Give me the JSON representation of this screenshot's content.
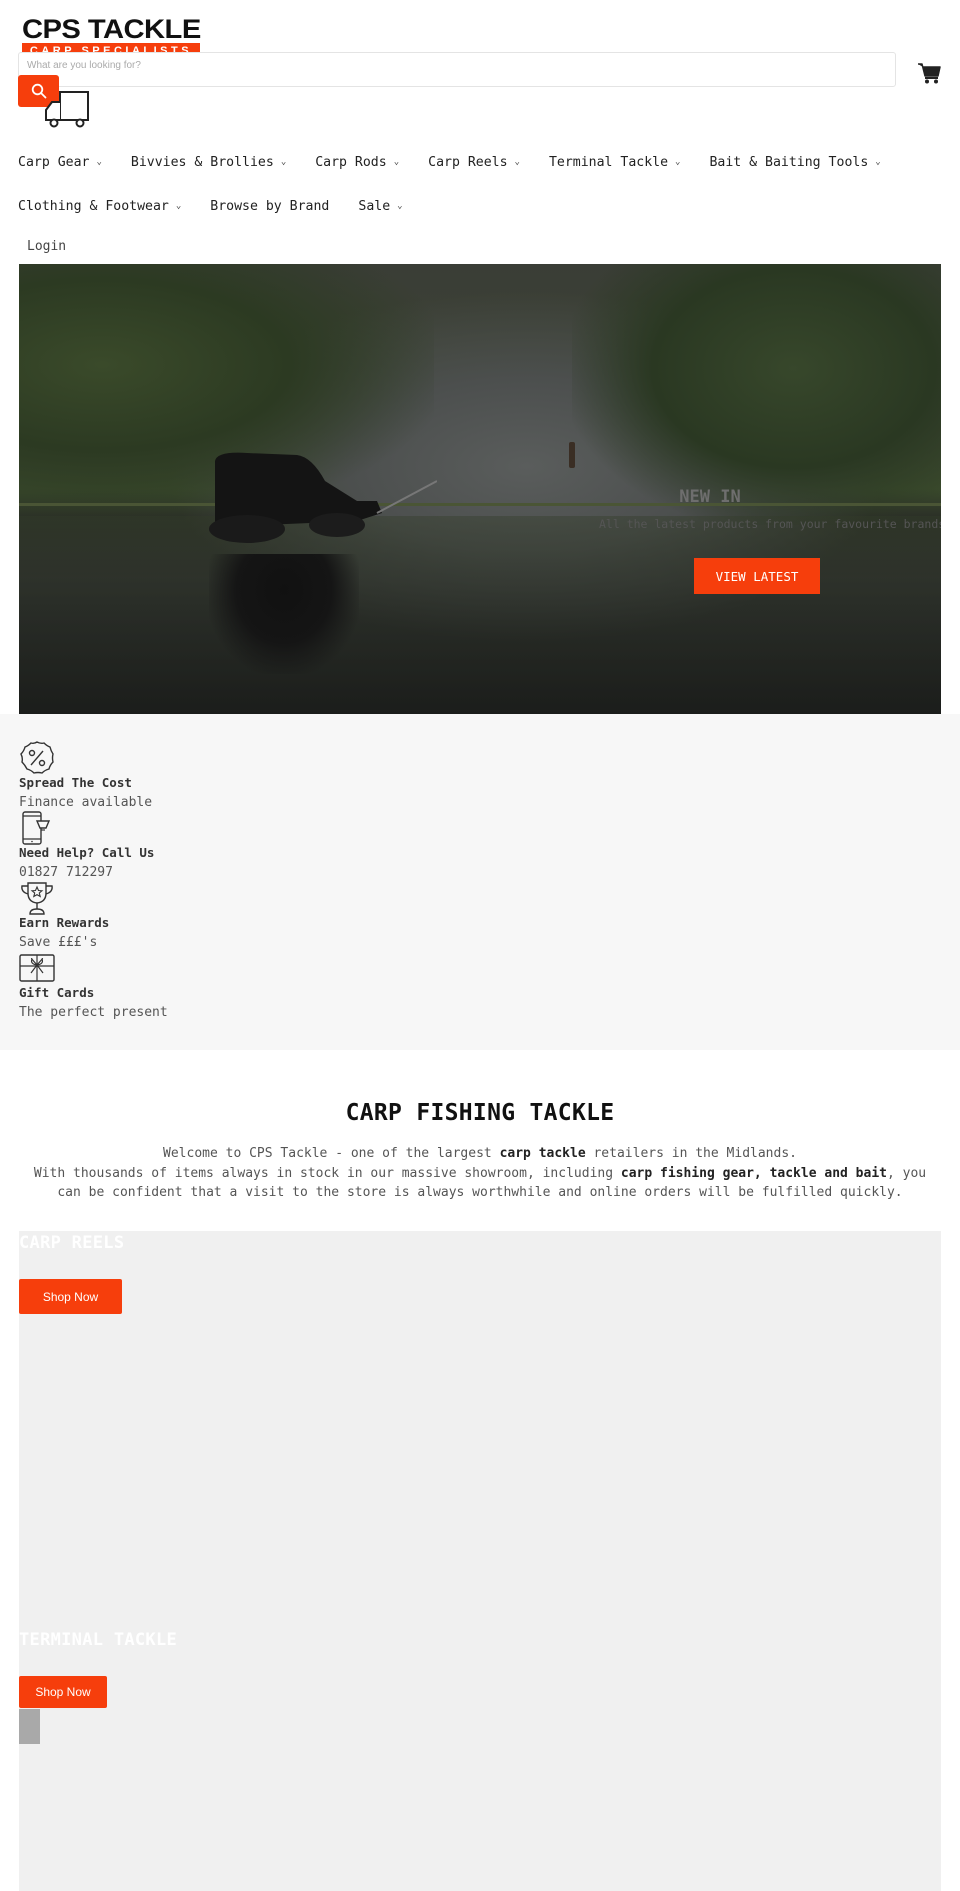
{
  "brand": {
    "logo_top": "CPS TACKLE",
    "logo_bottom": "CARP SPECIALISTS",
    "accent_color": "#f63e0c"
  },
  "search": {
    "placeholder": "What are you looking for?",
    "value": "",
    "button_icon": "search-icon"
  },
  "header_icons": {
    "delivery": "truck-icon",
    "cart": "cart-icon"
  },
  "nav": {
    "row1": [
      {
        "label": "Carp Gear",
        "dropdown": true
      },
      {
        "label": "Bivvies & Brollies",
        "dropdown": true
      },
      {
        "label": "Carp Rods",
        "dropdown": true
      },
      {
        "label": "Carp Reels",
        "dropdown": true
      },
      {
        "label": "Terminal Tackle",
        "dropdown": true
      },
      {
        "label": "Bait & Baiting Tools",
        "dropdown": true
      }
    ],
    "row2": [
      {
        "label": "Clothing & Footwear",
        "dropdown": true
      },
      {
        "label": "Browse by Brand",
        "dropdown": false
      },
      {
        "label": "Sale",
        "dropdown": true
      }
    ],
    "chevron": "⌄",
    "login": "Login"
  },
  "hero": {
    "title": "NEW IN",
    "subtitle": "All the latest products from your favourite brands",
    "button": "VIEW LATEST"
  },
  "features": [
    {
      "icon": "percent-badge-icon",
      "title": "Spread The Cost",
      "text": "Finance available"
    },
    {
      "icon": "phone-basket-icon",
      "title": "Need Help? Call Us",
      "text": "01827 712297"
    },
    {
      "icon": "trophy-icon",
      "title": "Earn Rewards",
      "text": "Save £££'s"
    },
    {
      "icon": "gift-card-icon",
      "title": "Gift Cards",
      "text": "The perfect present"
    }
  ],
  "intro": {
    "title": "CARP FISHING TACKLE",
    "line1_pre": "Welcome to CPS Tackle - one of the largest ",
    "line1_bold": "carp tackle",
    "line1_post": " retailers in the Midlands.",
    "line2_pre": "With thousands of items always in stock in our massive showroom, including ",
    "line2_bold": "carp fishing gear, tackle and bait",
    "line2_post": ", you can be confident that a visit to the store is always worthwhile and online orders will be fulfilled quickly."
  },
  "collections": [
    {
      "title": "CARP REELS",
      "button": "Shop Now"
    },
    {
      "title": "TERMINAL TACKLE",
      "button": "Shop Now"
    }
  ]
}
